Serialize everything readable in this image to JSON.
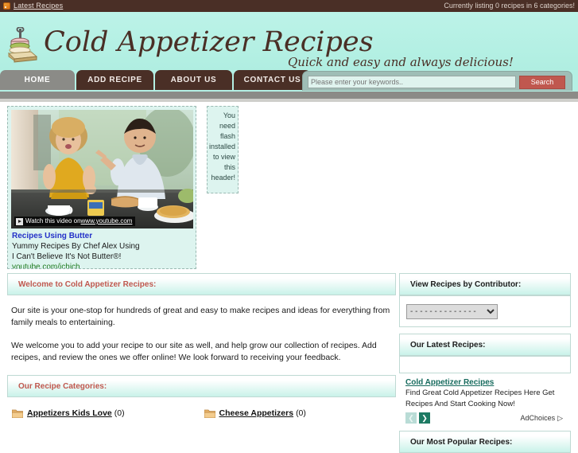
{
  "topbar": {
    "rss_icon": "rss-icon",
    "rss_label": "Latest Recipes",
    "status": "Currently listing 0 recipes in 6 categories!"
  },
  "masthead": {
    "logo_icon": "sandwich-stack-icon",
    "title": "Cold Appetizer Recipes",
    "tagline": "Quick and easy and always delicious!"
  },
  "nav": {
    "items": [
      {
        "label": "HOME",
        "active": true
      },
      {
        "label": "ADD RECIPE",
        "active": false
      },
      {
        "label": "ABOUT US",
        "active": false
      },
      {
        "label": "CONTACT US",
        "active": false
      }
    ]
  },
  "search": {
    "placeholder": "Please enter your keywords..",
    "value": "",
    "button_label": "Search"
  },
  "top_ad": {
    "video_overlay": {
      "play_icon": "play-icon",
      "prefix": "Watch this video on ",
      "url": "www.youtube.com"
    },
    "title": "Recipes Using Butter",
    "line1": "Yummy Recipes By Chef Alex Using",
    "line2": "I Can't Believe It's Not Butter®!",
    "line3": "youtube.com/ichjch"
  },
  "flash_notice": "You need flash installed to view this header!",
  "main": {
    "welcome": {
      "heading": "Welcome to Cold Appetizer Recipes:",
      "paragraph1": "Our site is your one-stop for hundreds of great and easy to make recipes and ideas for everything from family meals to entertaining.",
      "paragraph2": "We welcome you to add your recipe to our site as well, and help grow our collection of recipes. Add recipes, and review the ones we offer online! We look forward to receiving your feedback."
    },
    "categories": {
      "heading": "Our Recipe Categories:",
      "items": [
        {
          "icon": "folder-icon",
          "name": "Appetizers Kids Love",
          "count": "(0)"
        },
        {
          "icon": "folder-icon",
          "name": "Cheese Appetizers",
          "count": "(0)"
        }
      ]
    }
  },
  "sidebar": {
    "contributor": {
      "heading": "View Recipes by Contributor:",
      "selected": "- - - - - - - - - - - - - -",
      "options": [
        "- - - - - - - - - - - - - -"
      ]
    },
    "latest": {
      "heading": "Our Latest Recipes:"
    },
    "ad": {
      "title": "Cold Appetizer Recipes",
      "line1": "Find Great Cold Appetizer Recipes Here Get",
      "line2": "Recipes And Start Cooking Now!",
      "prev_icon": "chevron-left-icon",
      "next_icon": "chevron-right-icon",
      "adchoices_label": "AdChoices",
      "adchoices_icon": "adchoices-triangle-icon"
    },
    "popular": {
      "heading": "Our Most Popular Recipes:"
    }
  },
  "colors": {
    "brand_dark": "#4a2f26",
    "mint": "#b4f0e4",
    "accent_red": "#c0584f",
    "ad_green": "#1d7a63",
    "link_blue": "#2330c8"
  }
}
